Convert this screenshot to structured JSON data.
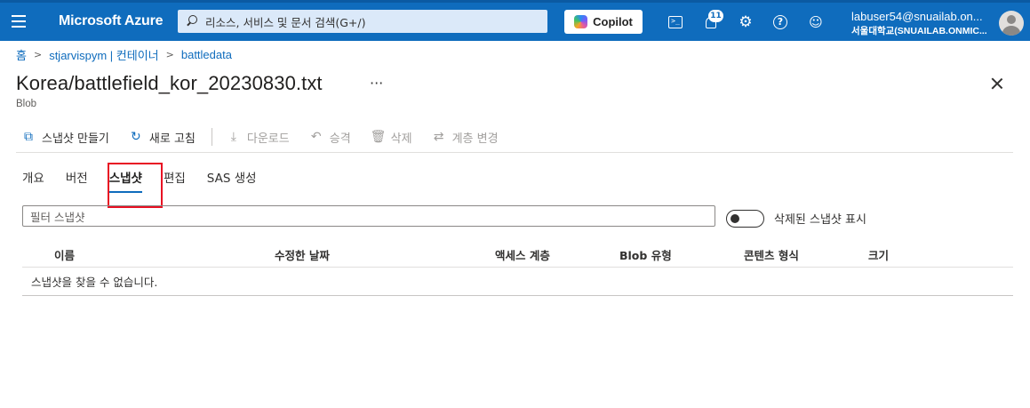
{
  "topbar": {
    "brand": "Microsoft Azure",
    "search_placeholder": "리소스, 서비스 및 문서 검색(G+/)",
    "copilot_label": "Copilot",
    "notification_count": "11",
    "user_name": "labuser54@snuailab.on...",
    "user_tenant": "서울대학교(SNUAILAB.ONMIC..."
  },
  "breadcrumb": {
    "items": [
      "홈",
      "stjarvispym | 컨테이너",
      "battledata"
    ]
  },
  "header": {
    "title": "Korea/battlefield_kor_20230830.txt",
    "subtitle": "Blob",
    "more": "···"
  },
  "toolbar": {
    "create_snapshot": "스냅샷 만들기",
    "refresh": "새로 고침",
    "download": "다운로드",
    "promote": "승격",
    "delete": "삭제",
    "change_tier": "계층 변경"
  },
  "tabs": [
    "개요",
    "버전",
    "스냅샷",
    "편집",
    "SAS 생성"
  ],
  "filter": {
    "placeholder": "필터 스냅샷",
    "toggle_label": "삭제된 스냅샷 표시",
    "toggle_on": false
  },
  "table": {
    "columns": [
      "이름",
      "수정한 날짜",
      "액세스 계층",
      "Blob 유형",
      "콘텐츠 형식",
      "크기"
    ],
    "empty_message": "스냅샷을 찾을 수 없습니다."
  },
  "colors": {
    "accent": "#0f6cbd",
    "highlight": "#e81123"
  }
}
